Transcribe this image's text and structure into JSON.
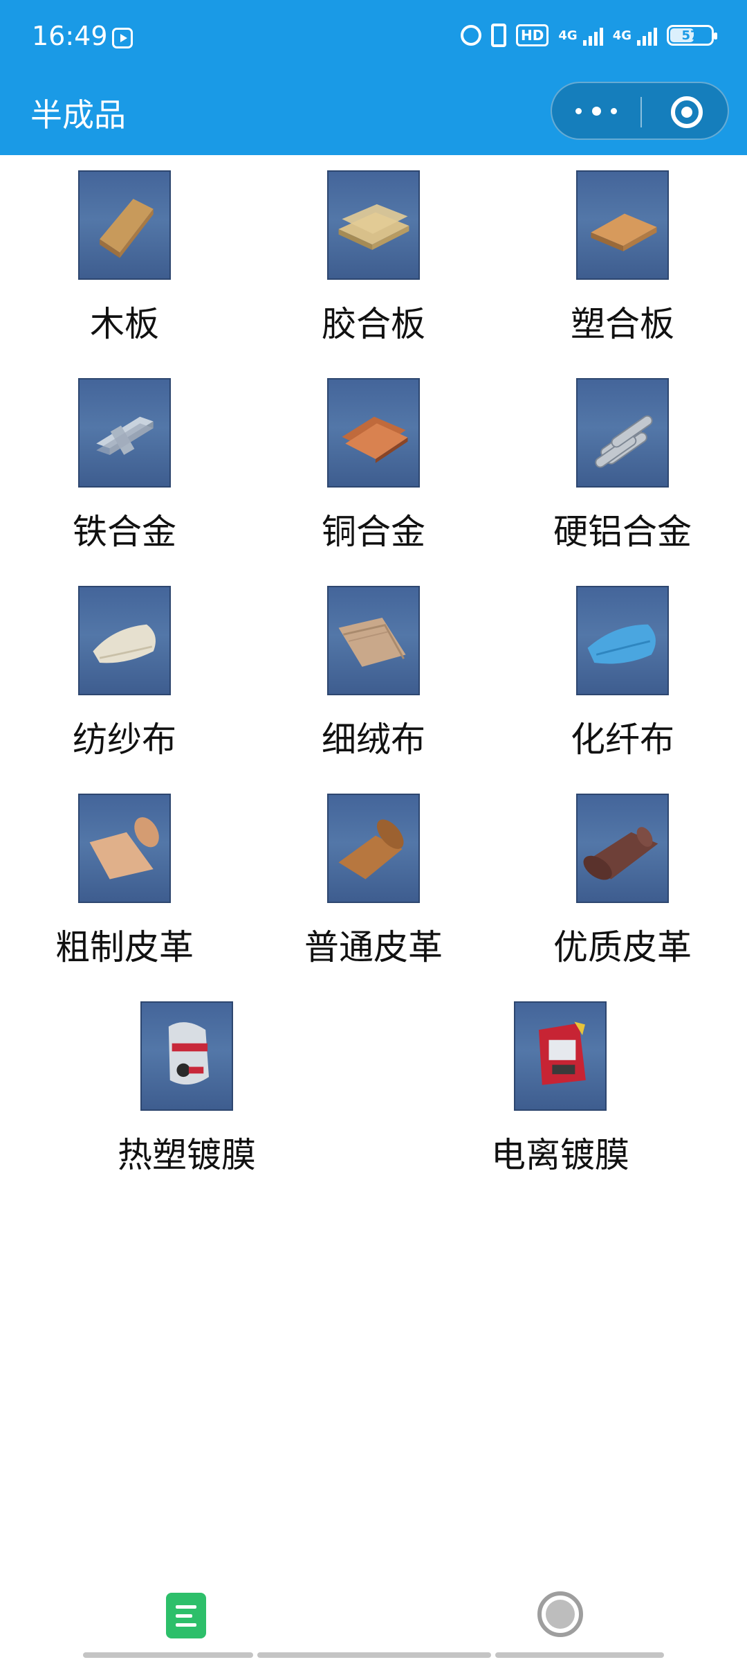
{
  "status_bar": {
    "time": "16:49",
    "hd": "HD",
    "net1": "4G",
    "net2": "4G",
    "battery": "57"
  },
  "header": {
    "title": "半成品",
    "color": "#1a9ae6"
  },
  "items": [
    {
      "label": "木板",
      "icon": "wood-plank-icon"
    },
    {
      "label": "胶合板",
      "icon": "plywood-icon"
    },
    {
      "label": "塑合板",
      "icon": "plastic-board-icon"
    },
    {
      "label": "铁合金",
      "icon": "iron-alloy-icon"
    },
    {
      "label": "铜合金",
      "icon": "copper-alloy-icon"
    },
    {
      "label": "硬铝合金",
      "icon": "duralumin-icon"
    },
    {
      "label": "纺纱布",
      "icon": "spun-cloth-icon"
    },
    {
      "label": "细绒布",
      "icon": "fine-flannel-icon"
    },
    {
      "label": "化纤布",
      "icon": "synthetic-fiber-cloth-icon"
    },
    {
      "label": "粗制皮革",
      "icon": "rough-leather-icon"
    },
    {
      "label": "普通皮革",
      "icon": "common-leather-icon"
    },
    {
      "label": "优质皮革",
      "icon": "quality-leather-icon"
    },
    {
      "label": "热塑镀膜",
      "icon": "thermoplastic-coating-icon"
    },
    {
      "label": "电离镀膜",
      "icon": "ionized-coating-icon"
    }
  ],
  "bottom_nav": {
    "left_icon": "document-list-icon",
    "right_icon": "home-circle-icon"
  }
}
